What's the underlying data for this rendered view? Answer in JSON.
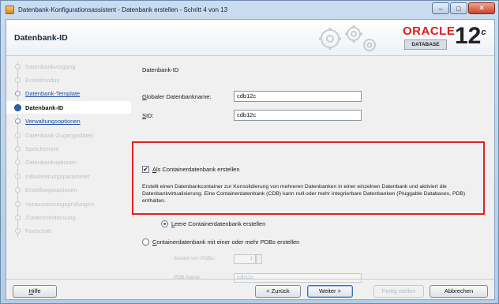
{
  "window": {
    "title": "Datenbank-Konfigurationsassistent - Datenbank erstellen - Schritt 4 von 13",
    "min_glyph": "–",
    "max_glyph": "□",
    "close_glyph": "✕"
  },
  "header": {
    "page_title": "Datenbank-ID",
    "oracle_word": "ORACLE",
    "oracle_db": "DATABASE",
    "version": "12",
    "version_sup": "c"
  },
  "nav": {
    "items": [
      {
        "label": "Datenbankvorgang",
        "state": "disabled"
      },
      {
        "label": "Erstellmodus",
        "state": "disabled"
      },
      {
        "label": "Datenbank-Template",
        "state": "link"
      },
      {
        "label": "Datenbank-ID",
        "state": "active"
      },
      {
        "label": "Verwaltungsoptionen",
        "state": "link"
      },
      {
        "label": "Datenbank-Zugangsdaten",
        "state": "disabled"
      },
      {
        "label": "Speicherorte",
        "state": "disabled"
      },
      {
        "label": "Datenbankoptionen",
        "state": "disabled"
      },
      {
        "label": "Initialisierungsparameter",
        "state": "disabled"
      },
      {
        "label": "Erstellungsoptionen",
        "state": "disabled"
      },
      {
        "label": "Voraussetzungsprüfungen",
        "state": "disabled"
      },
      {
        "label": "Zusammenfassung",
        "state": "disabled"
      },
      {
        "label": "Fortschritt",
        "state": "disabled"
      }
    ]
  },
  "main": {
    "section_title": "Datenbank-ID",
    "global_name_label_ul": "G",
    "global_name_label_rest": "lobaler Datenbankname:",
    "global_name_value": "cdb12c",
    "sid_label_ul": "S",
    "sid_label_rest": "ID:",
    "sid_value": "cdb12c",
    "cdb_checkbox_ul": "A",
    "cdb_checkbox_rest": "ls Containerdatenbank erstellen",
    "cdb_checked_glyph": "✔",
    "description": "Erstellt einen Datenbankcontainer zur Konsolidierung von mehreren Datenbanken in einer einzelnen Datenbank und aktiviert die Datenbankvirtualisierung. Eine Containerdatenbank (CDB) kann null oder mehr integrierbare Datenbanken (Pluggable Databases, PDB) enthalten.",
    "radio_empty_ul": "L",
    "radio_empty_rest": "eere Containerdatenbank erstellen",
    "radio_pdb_ul": "C",
    "radio_pdb_rest": "ontainerdatenbank mit einer oder mehr PDBs erstellen",
    "pdb_count_label": "Anzahl von PDBs:",
    "pdb_count_value": "1",
    "pdb_name_label": "PDB-Name:",
    "pdb_name_value": "cdb12c"
  },
  "footer": {
    "help_ul": "H",
    "help_rest": "ilfe",
    "back_label": "< Zurück",
    "next_label": "Weiter >",
    "finish_label": "Fertig stellen",
    "cancel_label": "Abbrechen"
  },
  "colors": {
    "highlight": "#e02020",
    "link": "#1f4fa3",
    "active_dot": "#2a62b3",
    "oracle_red": "#e11d1d"
  }
}
